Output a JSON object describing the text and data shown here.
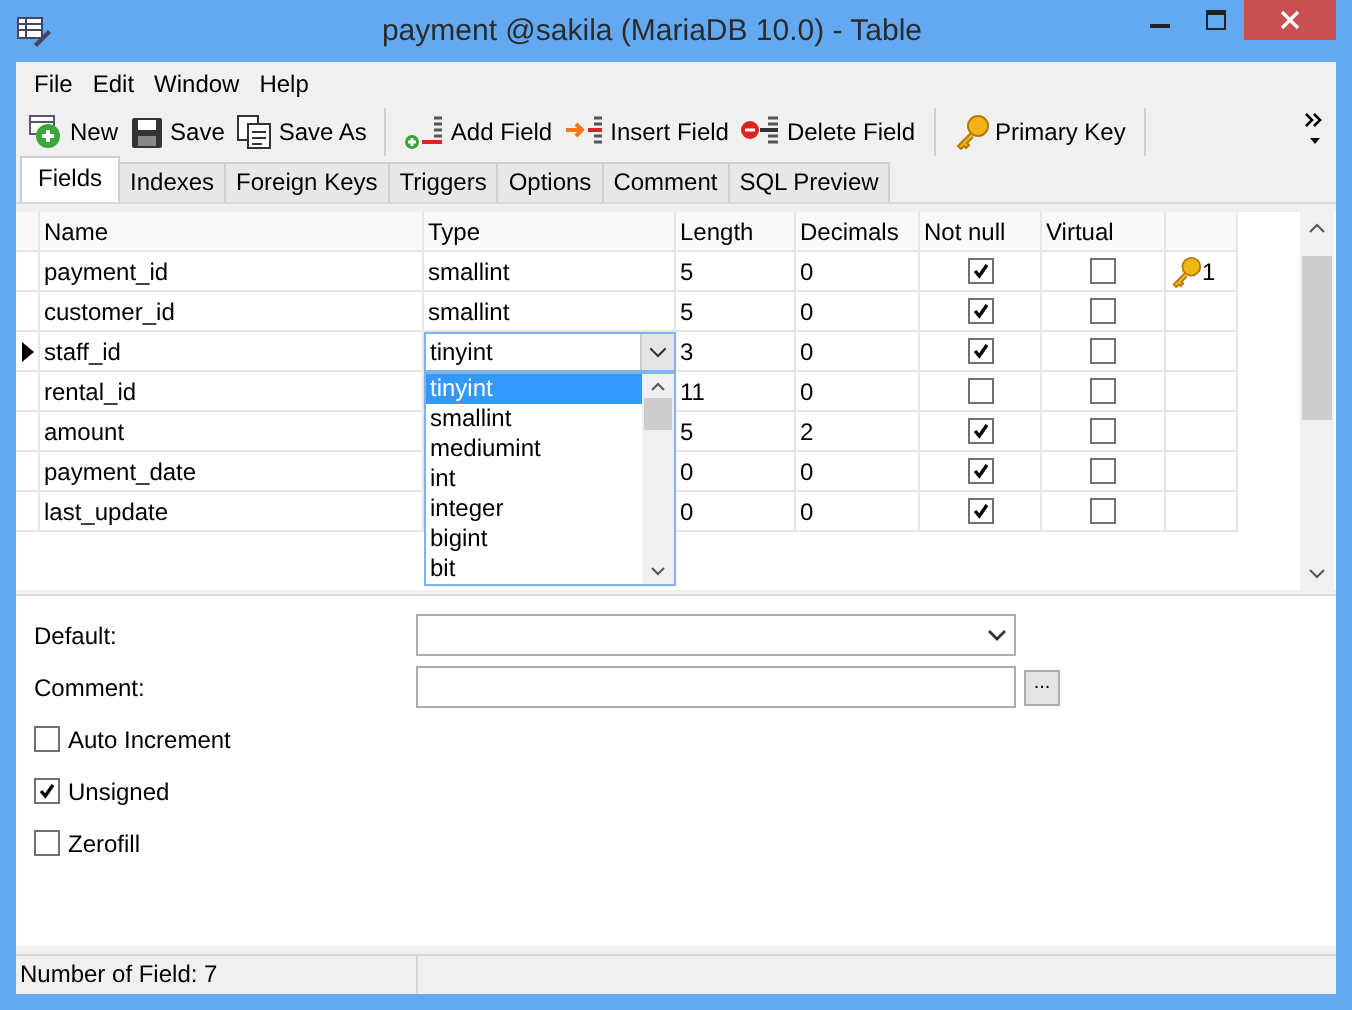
{
  "window": {
    "title": "payment @sakila (MariaDB 10.0) - Table"
  },
  "menu": [
    "File",
    "Edit",
    "Window",
    "Help"
  ],
  "toolbar": [
    [
      {
        "label": "New",
        "kind": "new"
      },
      {
        "label": "Save",
        "kind": "save"
      },
      {
        "label": "Save As",
        "kind": "saveas"
      }
    ],
    [
      {
        "label": "Add Field",
        "kind": "add"
      },
      {
        "label": "Insert Field",
        "kind": "insert"
      },
      {
        "label": "Delete Field",
        "kind": "delete"
      }
    ],
    [
      {
        "label": "Primary Key",
        "kind": "key"
      }
    ]
  ],
  "tabs": [
    {
      "label": "Fields",
      "selected": true
    },
    {
      "label": "Indexes",
      "selected": false
    },
    {
      "label": "Foreign Keys",
      "selected": false
    },
    {
      "label": "Triggers",
      "selected": false
    },
    {
      "label": "Options",
      "selected": false
    },
    {
      "label": "Comment",
      "selected": false
    },
    {
      "label": "SQL Preview",
      "selected": false
    }
  ],
  "table": {
    "columns": [
      "Name",
      "Type",
      "Length",
      "Decimals",
      "Not null",
      "Virtual"
    ],
    "rows": [
      {
        "name": "payment_id",
        "type": "smallint",
        "length": "5",
        "decimals": "0",
        "not_null": true,
        "virtual": false,
        "key": "1",
        "current": false
      },
      {
        "name": "customer_id",
        "type": "smallint",
        "length": "5",
        "decimals": "0",
        "not_null": true,
        "virtual": false,
        "current": false
      },
      {
        "name": "staff_id",
        "type": "tinyint",
        "length": "3",
        "decimals": "0",
        "not_null": true,
        "virtual": false,
        "current": true
      },
      {
        "name": "rental_id",
        "length": "11",
        "decimals": "0",
        "not_null": false,
        "virtual": false,
        "current": false
      },
      {
        "name": "amount",
        "length": "5",
        "decimals": "2",
        "not_null": true,
        "virtual": false,
        "current": false
      },
      {
        "name": "payment_date",
        "length": "0",
        "decimals": "0",
        "not_null": true,
        "virtual": false,
        "current": false
      },
      {
        "name": "last_update",
        "length": "0",
        "decimals": "0",
        "not_null": true,
        "virtual": false,
        "current": false
      }
    ]
  },
  "type_dropdown": {
    "options": [
      {
        "label": "tinyint",
        "selected": true
      },
      {
        "label": "smallint",
        "selected": false
      },
      {
        "label": "mediumint",
        "selected": false
      },
      {
        "label": "int",
        "selected": false
      },
      {
        "label": "integer",
        "selected": false
      },
      {
        "label": "bigint",
        "selected": false
      },
      {
        "label": "bit",
        "selected": false
      }
    ]
  },
  "properties": {
    "default_label": "Default:",
    "comment_label": "Comment:",
    "comment_button": "...",
    "checkboxes": [
      {
        "label": "Auto Increment",
        "checked": false
      },
      {
        "label": "Unsigned",
        "checked": true
      },
      {
        "label": "Zerofill",
        "checked": false
      }
    ]
  },
  "status_bar": "Number of Field: 7"
}
